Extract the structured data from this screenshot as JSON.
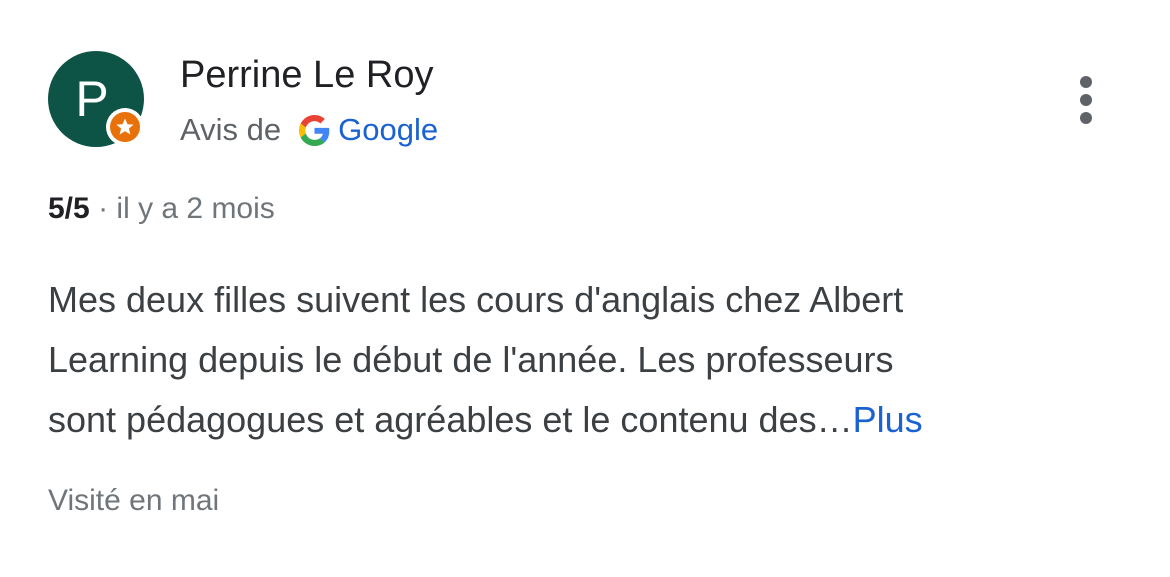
{
  "reviewer": {
    "initial": "P",
    "name": "Perrine Le Roy",
    "avatar_color": "#0d5346",
    "badge_icon": "local-guide-star-icon",
    "badge_color": "#e8710a"
  },
  "source": {
    "prefix": "Avis de",
    "icon": "google-g-icon",
    "name": "Google",
    "link_color": "#1a62d2"
  },
  "menu": {
    "icon": "more-vertical-icon"
  },
  "rating": {
    "score": "5/5",
    "separator": "·",
    "time": "il y a 2 mois"
  },
  "review": {
    "lines": [
      "Mes deux filles suivent les cours d'anglais chez Albert",
      "Learning depuis le début de l'année. Les professeurs",
      "sont pédagogues et agréables et le contenu des…"
    ],
    "more_label": "Plus"
  },
  "visit": {
    "text": "Visité en mai"
  }
}
